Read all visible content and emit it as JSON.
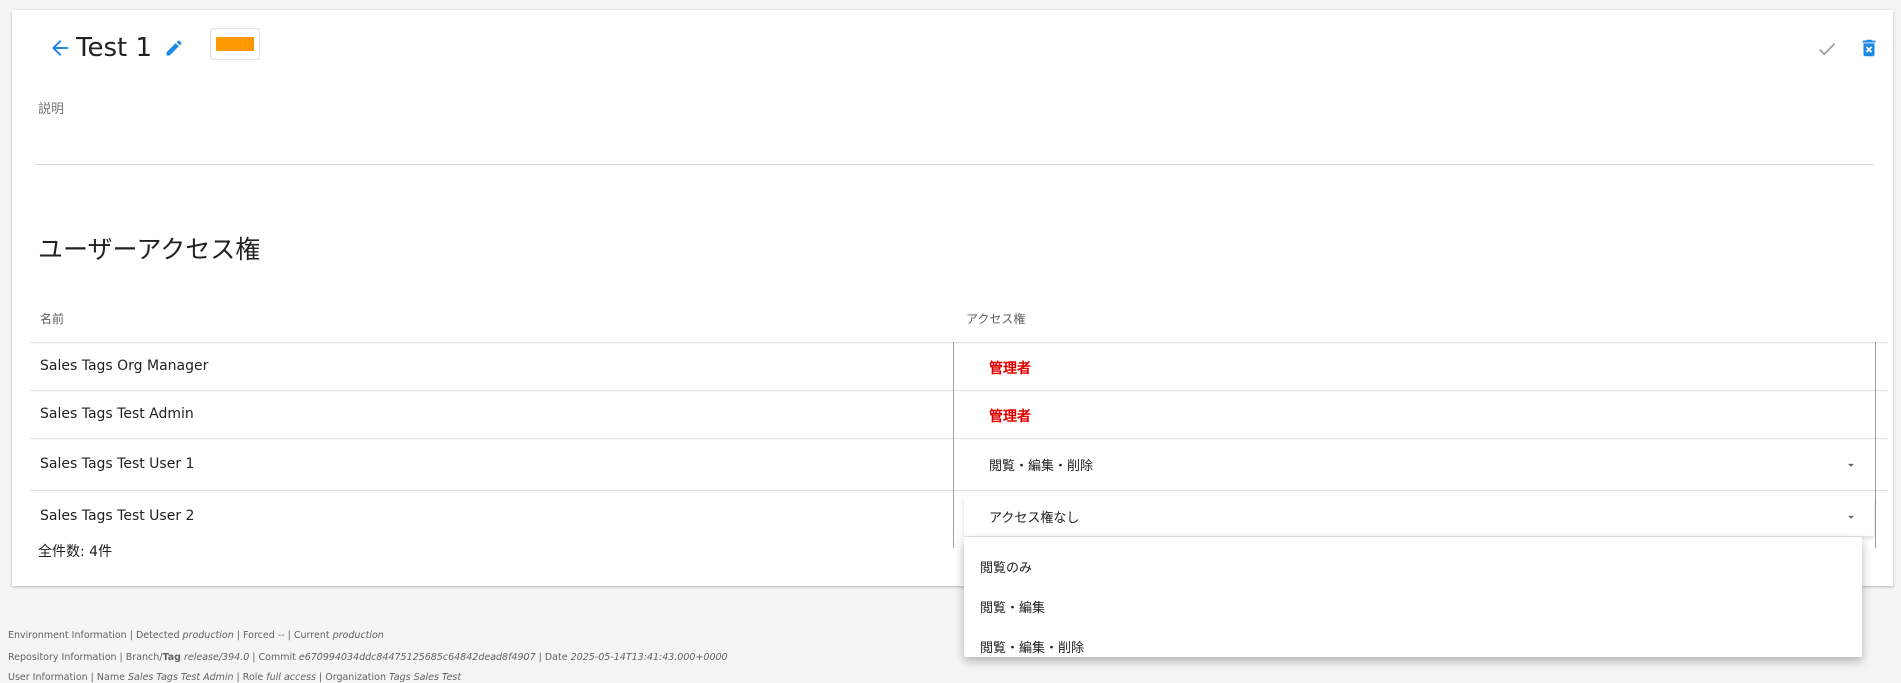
{
  "header": {
    "title": "Test 1",
    "tag_color": "#ff9800",
    "accent_color": "#1e88e5"
  },
  "description": {
    "label": "説明",
    "value": ""
  },
  "section": {
    "title": "ユーザーアクセス権"
  },
  "table": {
    "headers": {
      "name": "名前",
      "access": "アクセス権"
    },
    "rows": [
      {
        "name": "Sales Tags Org Manager",
        "access": "管理者",
        "type": "admin"
      },
      {
        "name": "Sales Tags Test Admin",
        "access": "管理者",
        "type": "admin"
      },
      {
        "name": "Sales Tags Test User 1",
        "access": "閲覧・編集・削除",
        "type": "select"
      },
      {
        "name": "Sales Tags Test User 2",
        "access": "アクセス権なし",
        "type": "select"
      }
    ],
    "total": "全件数: 4件",
    "admin_color": "#e10000"
  },
  "menu": {
    "options": [
      "閲覧のみ",
      "閲覧・編集",
      "閲覧・編集・削除"
    ]
  },
  "footer": {
    "env": {
      "label": "Environment Information |",
      "detected_label": "Detected",
      "detected": "production",
      "forced_label": "Forced",
      "forced": "--",
      "current_label": "Current",
      "current": "production"
    },
    "repo": {
      "label": "Repository Information |",
      "branch_label": "Branch/",
      "tag_label": "Tag",
      "branch": "release/394.0",
      "commit_label": "Commit",
      "commit": "e670994034ddc84475125685c64842dead8f4907",
      "date_label": "Date",
      "date": "2025-05-14T13:41:43.000+0000"
    },
    "user": {
      "label": "User Information |",
      "name_label": "Name",
      "name": "Sales Tags Test Admin",
      "role_label": "Role",
      "role": "full access",
      "org_label": "Organization",
      "org": "Tags Sales Test"
    }
  }
}
